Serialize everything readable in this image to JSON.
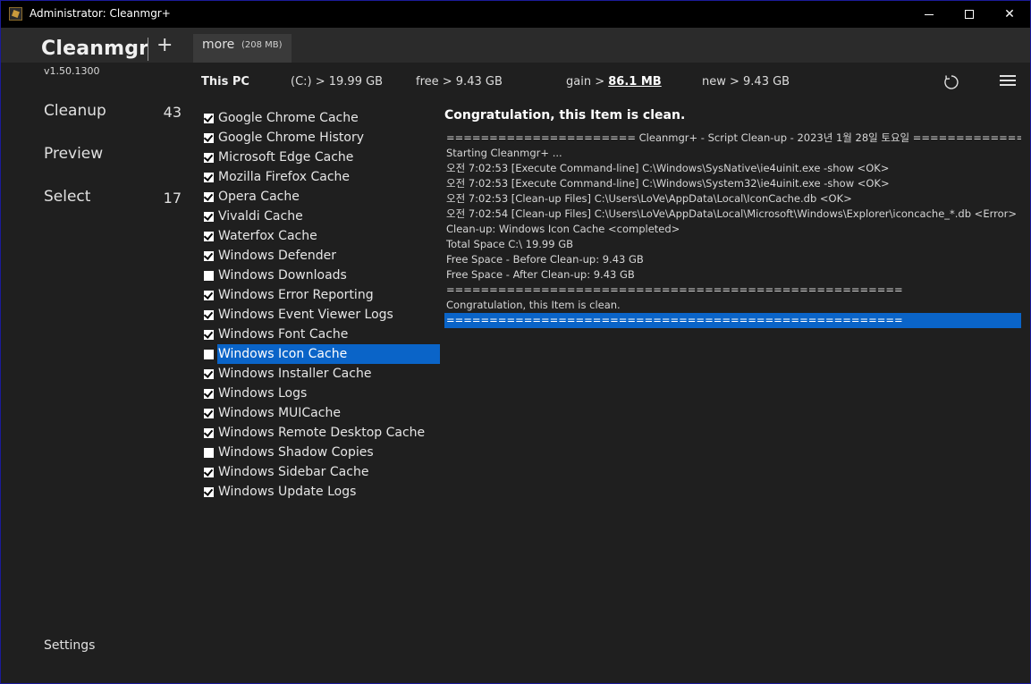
{
  "window": {
    "title": "Administrator: Cleanmgr+"
  },
  "app": {
    "name": "Cleanmgr",
    "version": "v1.50.1300",
    "plus_label": "+"
  },
  "tab_more": {
    "label": "more",
    "size": "(208 MB)"
  },
  "nav": [
    {
      "label": "Cleanup",
      "count": "43"
    },
    {
      "label": "Preview",
      "count": ""
    },
    {
      "label": "Select",
      "count": "17"
    }
  ],
  "settings_label": "Settings",
  "info": {
    "pc": "This PC",
    "drive": "(C:) > 19.99 GB",
    "free": "free >  9.43 GB",
    "gain_label": "gain >",
    "gain_value": "86.1 MB",
    "new": "new >  9.43 GB"
  },
  "items": [
    {
      "label": "Google Chrome Cache",
      "checked": true
    },
    {
      "label": "Google Chrome History",
      "checked": true
    },
    {
      "label": "Microsoft Edge Cache",
      "checked": true
    },
    {
      "label": "Mozilla Firefox Cache",
      "checked": true
    },
    {
      "label": "Opera Cache",
      "checked": true
    },
    {
      "label": "Vivaldi Cache",
      "checked": true
    },
    {
      "label": "Waterfox Cache",
      "checked": true
    },
    {
      "label": "Windows Defender",
      "checked": true
    },
    {
      "label": "Windows Downloads",
      "checked": false
    },
    {
      "label": "Windows Error Reporting",
      "checked": true
    },
    {
      "label": "Windows Event Viewer Logs",
      "checked": true
    },
    {
      "label": "Windows Font Cache",
      "checked": true
    },
    {
      "label": "Windows Icon Cache",
      "checked": false,
      "selected": true
    },
    {
      "label": "Windows Installer Cache",
      "checked": true
    },
    {
      "label": "Windows Logs",
      "checked": true
    },
    {
      "label": "Windows MUICache",
      "checked": true
    },
    {
      "label": "Windows Remote Desktop Cache",
      "checked": true
    },
    {
      "label": "Windows Shadow Copies",
      "checked": false
    },
    {
      "label": "Windows Sidebar Cache",
      "checked": true
    },
    {
      "label": "Windows Update Logs",
      "checked": true
    }
  ],
  "result": {
    "title": "Congratulation, this Item is clean.",
    "log": [
      "====================== Cleanmgr+ - Script Clean-up - 2023년 1월 28일 토요일 ================",
      "Starting Cleanmgr+ ...",
      "오전 7:02:53 [Execute Command-line] C:\\Windows\\SysNative\\ie4uinit.exe -show <OK>",
      "오전 7:02:53 [Execute Command-line] C:\\Windows\\System32\\ie4uinit.exe -show <OK>",
      "오전 7:02:53 [Clean-up Files] C:\\Users\\LoVe\\AppData\\Local\\IconCache.db <OK>",
      "오전 7:02:54 [Clean-up Files] C:\\Users\\LoVe\\AppData\\Local\\Microsoft\\Windows\\Explorer\\iconcache_*.db <Error>",
      "Clean-up: Windows Icon Cache <completed>",
      "Total Space C:\\ 19.99 GB",
      "Free Space - Before Clean-up: 9.43 GB",
      "Free Space - After Clean-up: 9.43 GB",
      "=====================================================",
      "Congratulation, this Item is clean.",
      "====================================================="
    ],
    "highlight_index": 12
  }
}
